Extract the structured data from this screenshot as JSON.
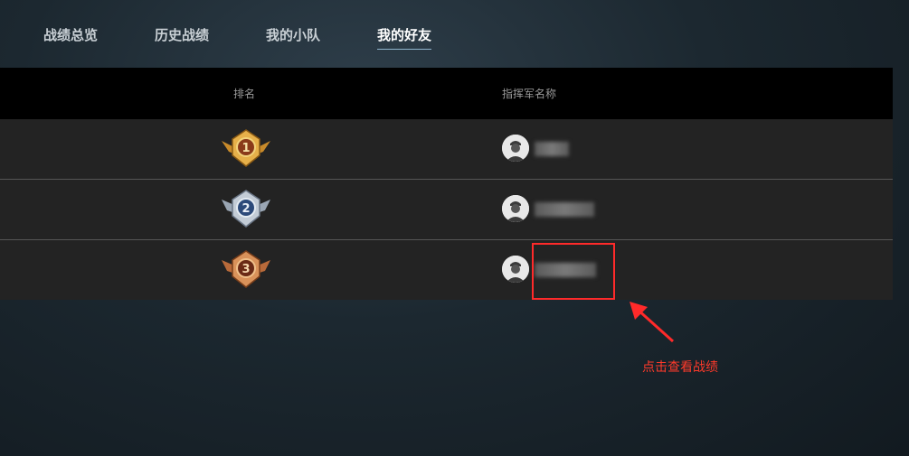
{
  "tabs": [
    {
      "label": "战绩总览",
      "active": false
    },
    {
      "label": "历史战绩",
      "active": false
    },
    {
      "label": "我的小队",
      "active": false
    },
    {
      "label": "我的好友",
      "active": true
    }
  ],
  "table": {
    "headers": {
      "rank": "排名",
      "name": "指挥军名称"
    },
    "rows": [
      {
        "rank": "1",
        "medal": "gold-medal-icon",
        "name_visible": false
      },
      {
        "rank": "2",
        "medal": "silver-medal-icon",
        "name_visible": false
      },
      {
        "rank": "3",
        "medal": "bronze-medal-icon",
        "name_visible": false
      }
    ]
  },
  "annotation": {
    "hint": "点击查看战绩",
    "color": "#ff2a2a"
  },
  "colors": {
    "active_tab_underline": "#8fb4cc",
    "header_bg": "#000000",
    "row_bg": "#232323"
  }
}
